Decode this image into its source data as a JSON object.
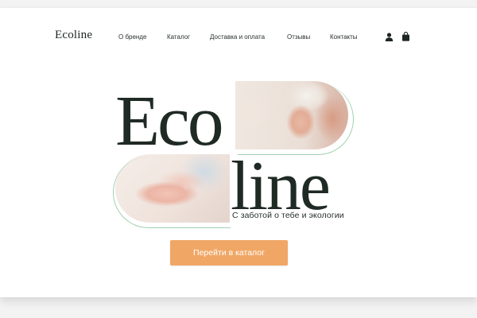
{
  "header": {
    "logo": "Ecoline",
    "nav": [
      {
        "label": "О бренде"
      },
      {
        "label": "Каталог"
      },
      {
        "label": "Доставка и оплата"
      },
      {
        "label": "Отзывы"
      },
      {
        "label": "Контакты"
      }
    ],
    "icons": [
      "user-icon",
      "shopping-bag-icon"
    ]
  },
  "hero": {
    "title_part1": "Eco",
    "title_part2": "line",
    "tagline": "С заботой о тебе и экологии",
    "cta_label": "Перейти в каталог",
    "images": [
      "woman-with-towel-photo",
      "hands-applying-cream-photo"
    ]
  },
  "colors": {
    "accent": "#f0a766",
    "text": "#1f2a24",
    "outline": "#9fcfb0",
    "background": "#ffffff"
  }
}
